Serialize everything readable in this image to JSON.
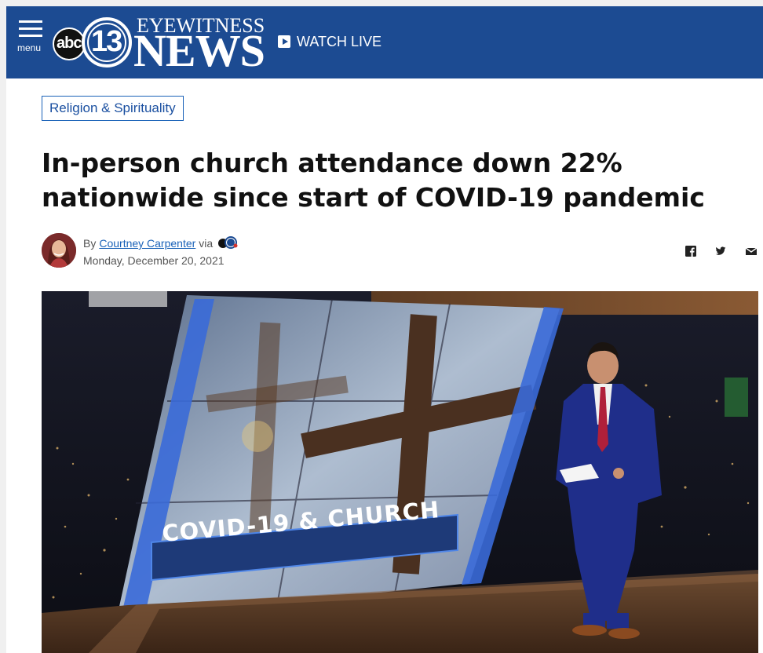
{
  "header": {
    "menu_label": "menu",
    "logo_abc": "abc",
    "logo_channel": "13",
    "logo_eyewitness": "EYEWITNESS",
    "logo_news": "NEWS",
    "watch_live_label": "WATCH LIVE",
    "bar_color": "#1c4b92"
  },
  "article": {
    "category": "Religion & Spirituality",
    "headline_line1": "In-person church attendance down 22%",
    "headline_line2": "nationwide since start of COVID-19 pandemic",
    "byline_prefix": "By",
    "author": "Courtney Carpenter",
    "via": "via",
    "date": "Monday, December 20, 2021"
  },
  "share": {
    "facebook": "facebook-icon",
    "twitter": "twitter-icon",
    "email": "email-icon"
  },
  "video": {
    "lower_third": "COVID-19 & CHURCH"
  },
  "colors": {
    "accent": "#1a62b8",
    "headline": "#111111"
  }
}
